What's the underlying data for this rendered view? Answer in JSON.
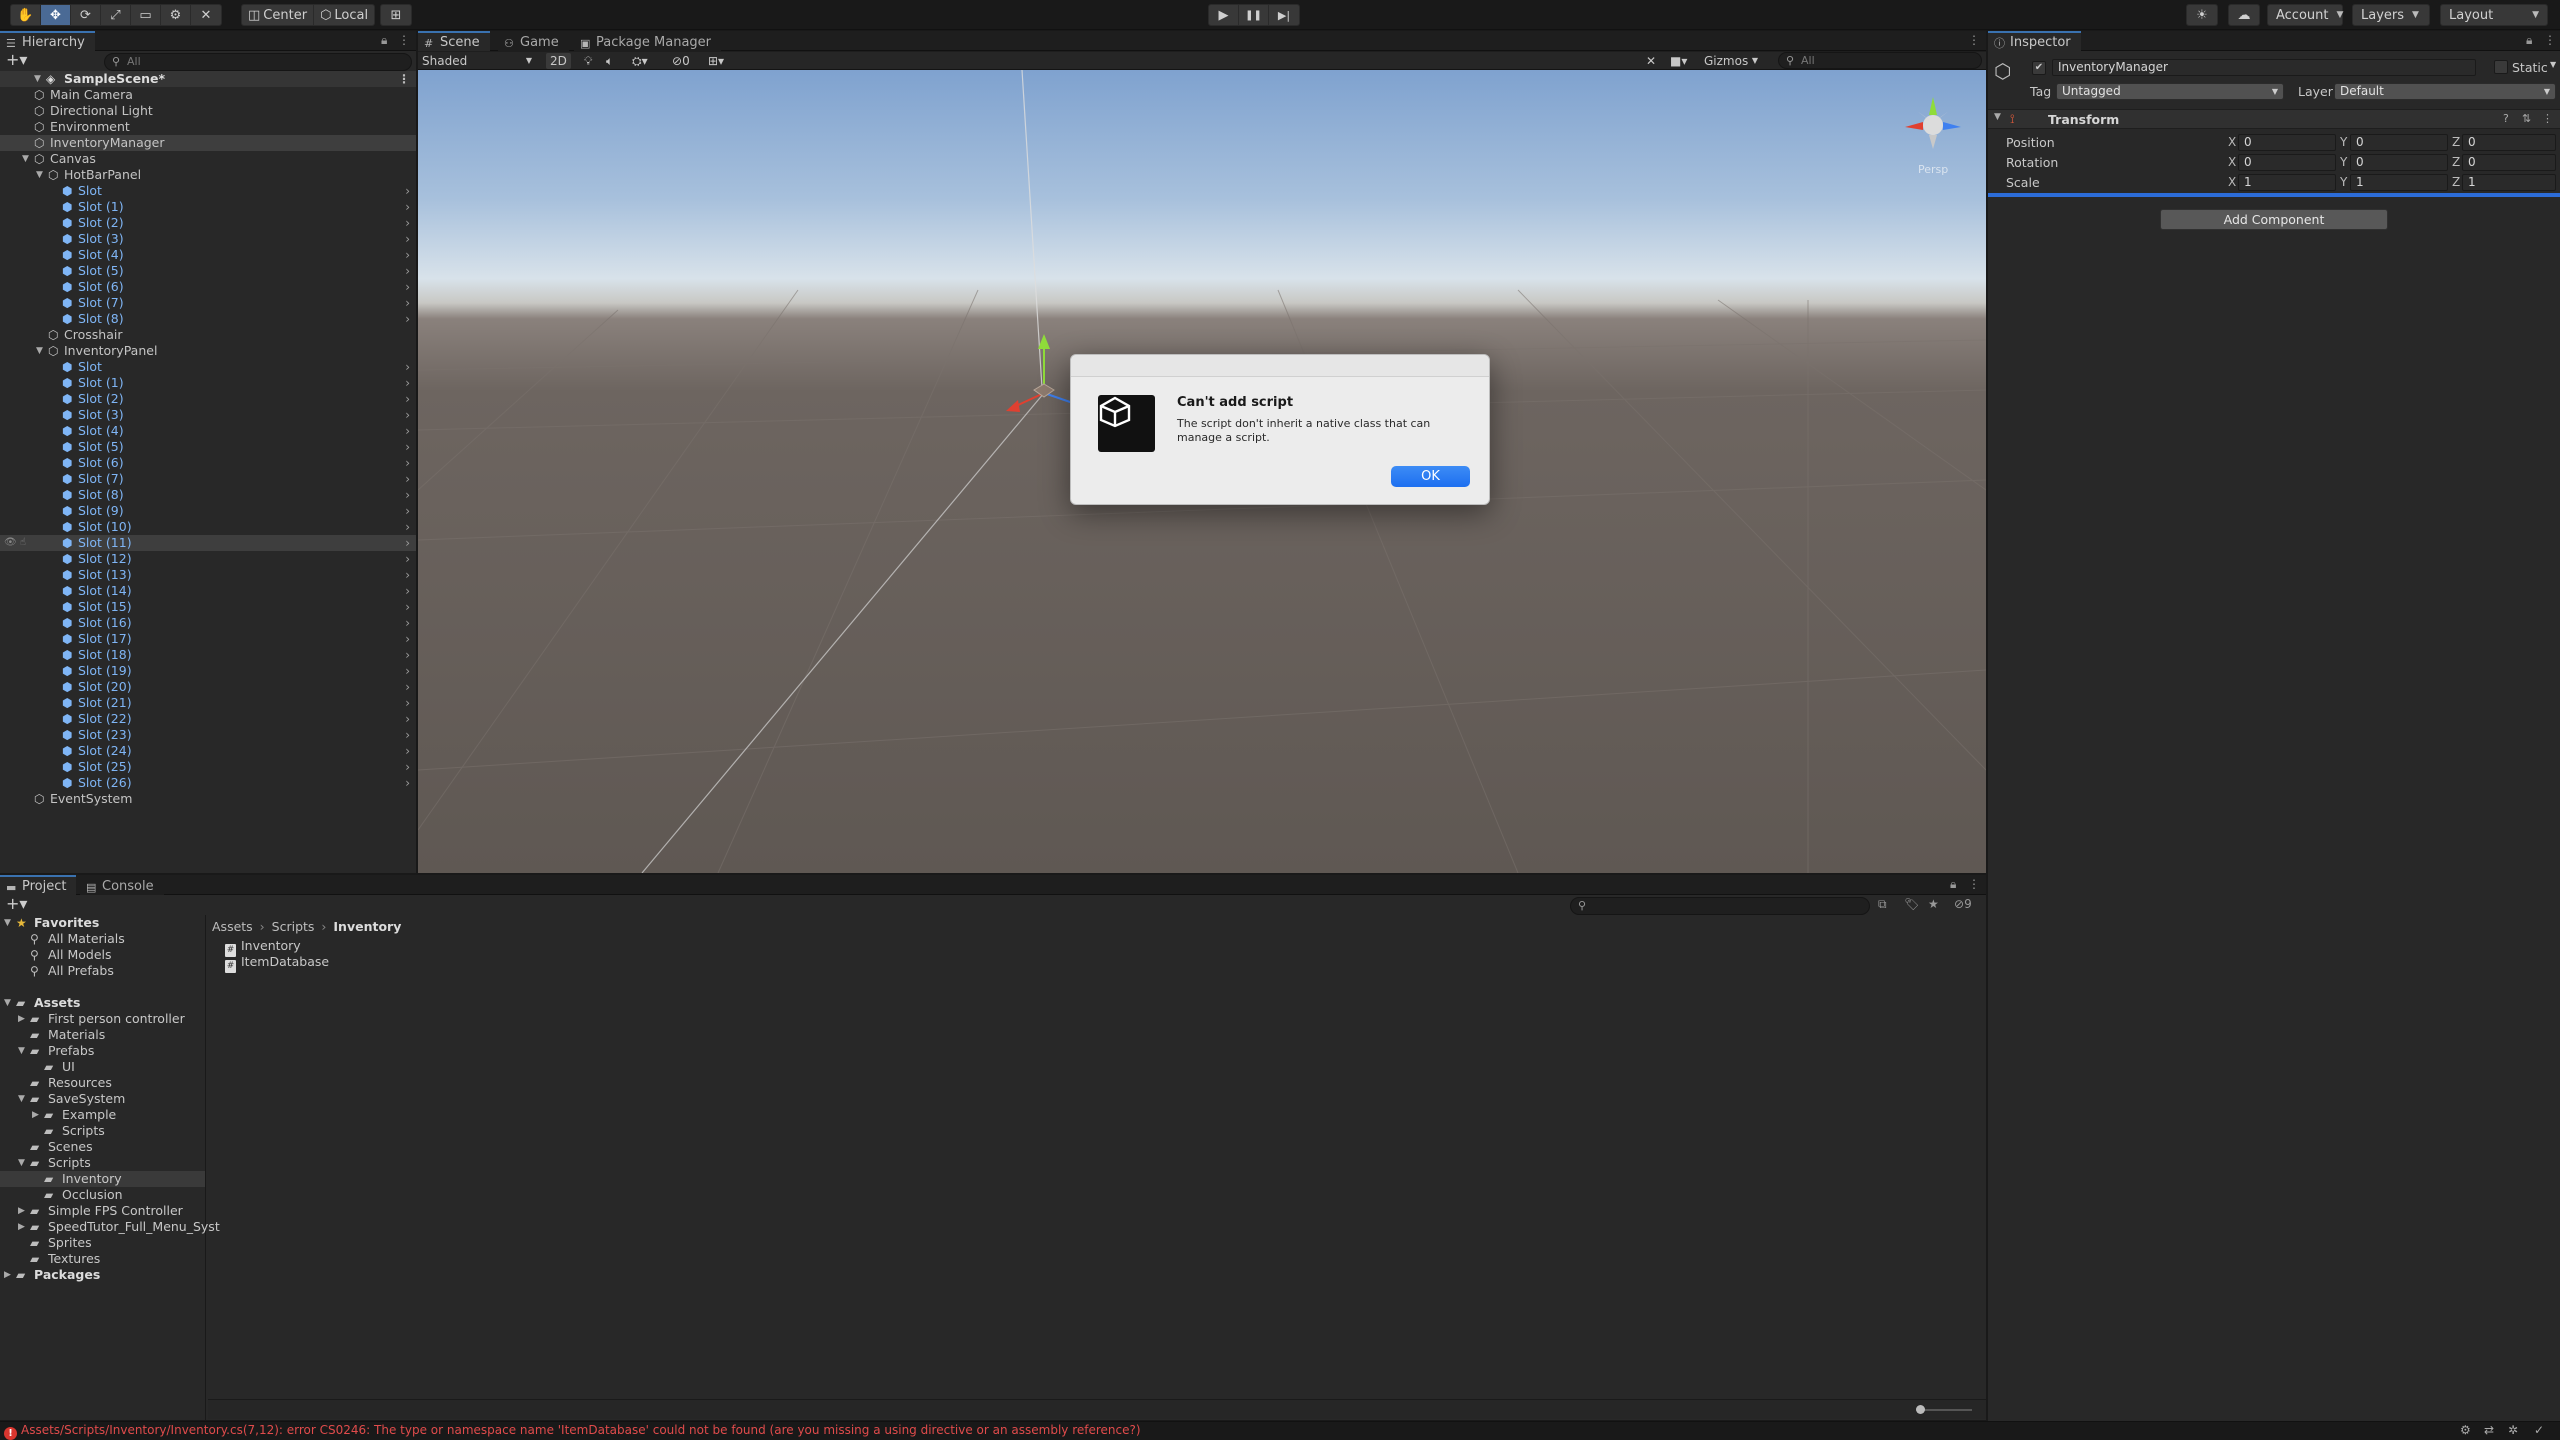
{
  "toolbar": {
    "tools": [
      "✋",
      "✥",
      "⟳",
      "⤢",
      "▭",
      "⚙",
      "✕"
    ],
    "pivot_center": "Center",
    "pivot_local": "Local",
    "snap_icon": "grid-icon",
    "play": "▶",
    "pause": "❚❚",
    "step": "▶|",
    "account": "Account",
    "layers": "Layers",
    "layout": "Layout"
  },
  "hierarchy": {
    "tab": "Hierarchy",
    "search_placeholder": "All",
    "scene": "SampleScene*",
    "items": [
      {
        "name": "Main Camera",
        "depth": 1,
        "type": "go"
      },
      {
        "name": "Directional Light",
        "depth": 1,
        "type": "go"
      },
      {
        "name": "Environment",
        "depth": 1,
        "type": "go"
      },
      {
        "name": "InventoryManager",
        "depth": 1,
        "type": "go",
        "selected": true
      },
      {
        "name": "Canvas",
        "depth": 1,
        "type": "go",
        "expanded": true
      },
      {
        "name": "HotBarPanel",
        "depth": 2,
        "type": "go",
        "expanded": true
      },
      {
        "name": "Slot",
        "depth": 3,
        "type": "prefab"
      },
      {
        "name": "Slot (1)",
        "depth": 3,
        "type": "prefab"
      },
      {
        "name": "Slot (2)",
        "depth": 3,
        "type": "prefab"
      },
      {
        "name": "Slot (3)",
        "depth": 3,
        "type": "prefab"
      },
      {
        "name": "Slot (4)",
        "depth": 3,
        "type": "prefab"
      },
      {
        "name": "Slot (5)",
        "depth": 3,
        "type": "prefab"
      },
      {
        "name": "Slot (6)",
        "depth": 3,
        "type": "prefab"
      },
      {
        "name": "Slot (7)",
        "depth": 3,
        "type": "prefab"
      },
      {
        "name": "Slot (8)",
        "depth": 3,
        "type": "prefab"
      },
      {
        "name": "Crosshair",
        "depth": 2,
        "type": "go"
      },
      {
        "name": "InventoryPanel",
        "depth": 2,
        "type": "go",
        "expanded": true
      },
      {
        "name": "Slot",
        "depth": 3,
        "type": "prefab"
      },
      {
        "name": "Slot (1)",
        "depth": 3,
        "type": "prefab"
      },
      {
        "name": "Slot (2)",
        "depth": 3,
        "type": "prefab"
      },
      {
        "name": "Slot (3)",
        "depth": 3,
        "type": "prefab"
      },
      {
        "name": "Slot (4)",
        "depth": 3,
        "type": "prefab"
      },
      {
        "name": "Slot (5)",
        "depth": 3,
        "type": "prefab"
      },
      {
        "name": "Slot (6)",
        "depth": 3,
        "type": "prefab"
      },
      {
        "name": "Slot (7)",
        "depth": 3,
        "type": "prefab"
      },
      {
        "name": "Slot (8)",
        "depth": 3,
        "type": "prefab"
      },
      {
        "name": "Slot (9)",
        "depth": 3,
        "type": "prefab"
      },
      {
        "name": "Slot (10)",
        "depth": 3,
        "type": "prefab"
      },
      {
        "name": "Slot (11)",
        "depth": 3,
        "type": "prefab",
        "hover": true
      },
      {
        "name": "Slot (12)",
        "depth": 3,
        "type": "prefab"
      },
      {
        "name": "Slot (13)",
        "depth": 3,
        "type": "prefab"
      },
      {
        "name": "Slot (14)",
        "depth": 3,
        "type": "prefab"
      },
      {
        "name": "Slot (15)",
        "depth": 3,
        "type": "prefab"
      },
      {
        "name": "Slot (16)",
        "depth": 3,
        "type": "prefab"
      },
      {
        "name": "Slot (17)",
        "depth": 3,
        "type": "prefab"
      },
      {
        "name": "Slot (18)",
        "depth": 3,
        "type": "prefab"
      },
      {
        "name": "Slot (19)",
        "depth": 3,
        "type": "prefab"
      },
      {
        "name": "Slot (20)",
        "depth": 3,
        "type": "prefab"
      },
      {
        "name": "Slot (21)",
        "depth": 3,
        "type": "prefab"
      },
      {
        "name": "Slot (22)",
        "depth": 3,
        "type": "prefab"
      },
      {
        "name": "Slot (23)",
        "depth": 3,
        "type": "prefab"
      },
      {
        "name": "Slot (24)",
        "depth": 3,
        "type": "prefab"
      },
      {
        "name": "Slot (25)",
        "depth": 3,
        "type": "prefab"
      },
      {
        "name": "Slot (26)",
        "depth": 3,
        "type": "prefab"
      },
      {
        "name": "EventSystem",
        "depth": 1,
        "type": "go"
      }
    ]
  },
  "scene": {
    "tabs": [
      "Scene",
      "Game",
      "Package Manager"
    ],
    "shading": "Shaded",
    "mode_2d": "2D",
    "hidden_count": "0",
    "gizmos": "Gizmos",
    "search_placeholder": "All",
    "persp_label": "Persp"
  },
  "dialog": {
    "title": "Can't add script",
    "message": "The script don't inherit a native class that can manage a script.",
    "ok": "OK"
  },
  "inspector": {
    "tab": "Inspector",
    "object_name": "InventoryManager",
    "static_label": "Static",
    "tag_label": "Tag",
    "tag_value": "Untagged",
    "layer_label": "Layer",
    "layer_value": "Default",
    "component": "Transform",
    "position_label": "Position",
    "rotation_label": "Rotation",
    "scale_label": "Scale",
    "position": {
      "x": "0",
      "y": "0",
      "z": "0"
    },
    "rotation": {
      "x": "0",
      "y": "0",
      "z": "0"
    },
    "scale": {
      "x": "1",
      "y": "1",
      "z": "1"
    },
    "add_component": "Add Component"
  },
  "project": {
    "tabs": [
      "Project",
      "Console"
    ],
    "hidden_count": "9",
    "favorites_label": "Favorites",
    "favorites": [
      "All Materials",
      "All Models",
      "All Prefabs"
    ],
    "assets_label": "Assets",
    "tree": [
      {
        "name": "First person controller",
        "depth": 1,
        "arrow": "right"
      },
      {
        "name": "Materials",
        "depth": 1
      },
      {
        "name": "Prefabs",
        "depth": 1,
        "arrow": "down"
      },
      {
        "name": "UI",
        "depth": 2
      },
      {
        "name": "Resources",
        "depth": 1
      },
      {
        "name": "SaveSystem",
        "depth": 1,
        "arrow": "down"
      },
      {
        "name": "Example",
        "depth": 2,
        "arrow": "right"
      },
      {
        "name": "Scripts",
        "depth": 2
      },
      {
        "name": "Scenes",
        "depth": 1
      },
      {
        "name": "Scripts",
        "depth": 1,
        "arrow": "down"
      },
      {
        "name": "Inventory",
        "depth": 2,
        "selected": true
      },
      {
        "name": "Occlusion",
        "depth": 2
      },
      {
        "name": "Simple FPS Controller",
        "depth": 1,
        "arrow": "right"
      },
      {
        "name": "SpeedTutor_Full_Menu_Syst",
        "depth": 1,
        "arrow": "right"
      },
      {
        "name": "Sprites",
        "depth": 1
      },
      {
        "name": "Textures",
        "depth": 1
      }
    ],
    "packages_label": "Packages",
    "breadcrumb": [
      "Assets",
      "Scripts",
      "Inventory"
    ],
    "files": [
      "Inventory",
      "ItemDatabase"
    ]
  },
  "status": {
    "error": "Assets/Scripts/Inventory/Inventory.cs(7,12): error CS0246: The type or namespace name 'ItemDatabase' could not be found (are you missing a using directive or an assembly reference?)"
  },
  "colors": {
    "prefab_text": "#7fb5f5",
    "accent": "#3a72b0",
    "error": "#e04b4b",
    "ok_button": "#1d6ff0"
  }
}
